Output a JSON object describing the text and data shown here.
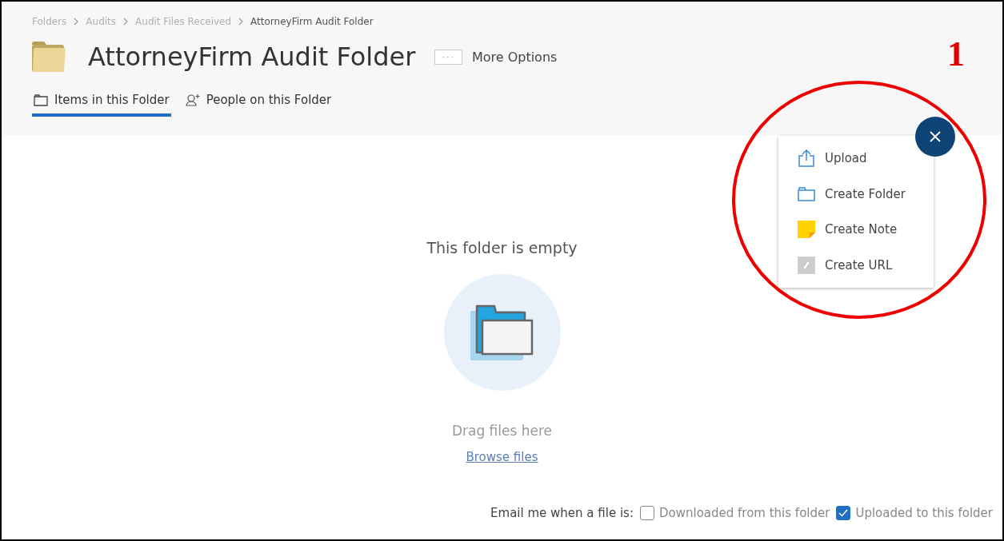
{
  "breadcrumb": [
    {
      "label": "Folders",
      "current": false
    },
    {
      "label": "Audits",
      "current": false
    },
    {
      "label": "Audit Files Received",
      "current": false
    },
    {
      "label": "AttorneyFirm Audit Folder",
      "current": true
    }
  ],
  "title": "AttorneyFirm Audit Folder",
  "more_options": {
    "icon": "···",
    "label": "More Options"
  },
  "tabs": [
    {
      "label": "Items in this Folder",
      "kind": "folder",
      "selected": true
    },
    {
      "label": "People on this Folder",
      "kind": "people",
      "selected": false
    }
  ],
  "annotation_number": "1",
  "menu": {
    "items": [
      {
        "label": "Upload",
        "kind": "upload"
      },
      {
        "label": "Create Folder",
        "kind": "folder"
      },
      {
        "label": "Create Note",
        "kind": "note"
      },
      {
        "label": "Create URL",
        "kind": "url"
      }
    ]
  },
  "empty_state": {
    "heading": "This folder is empty",
    "hint": "Drag files here",
    "link": "Browse files"
  },
  "notifications": {
    "label": "Email me when a file is:",
    "options": [
      {
        "label": "Downloaded from this folder",
        "checked": false
      },
      {
        "label": "Uploaded to this folder",
        "checked": true
      }
    ]
  }
}
